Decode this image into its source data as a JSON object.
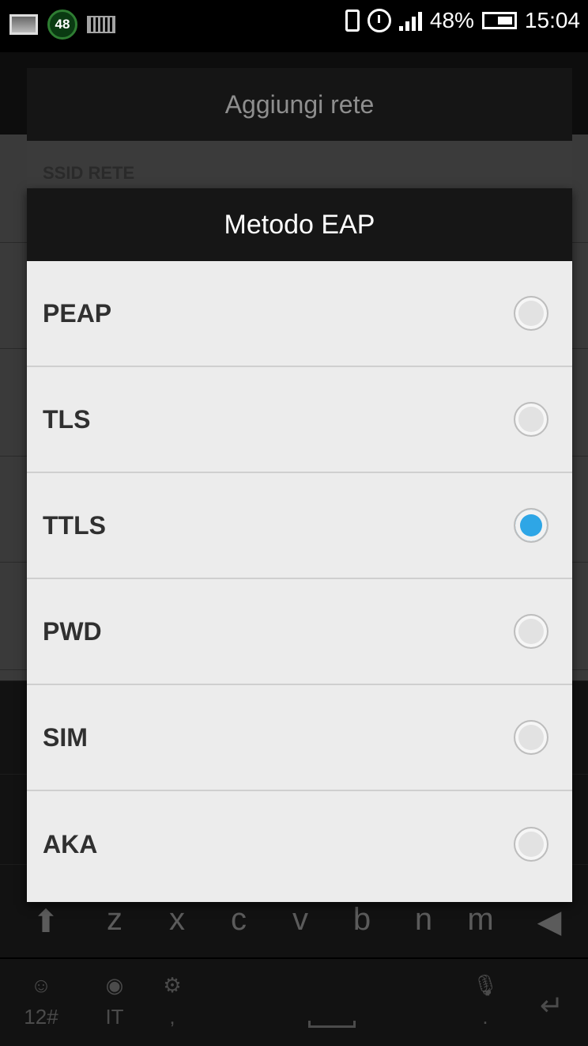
{
  "status_bar": {
    "badge_number": "48",
    "battery_percent": "48%",
    "time": "15:04"
  },
  "background_dialog": {
    "title": "Aggiungi rete",
    "ssid_label": "SSID RETE"
  },
  "eap_dialog": {
    "title": "Metodo EAP",
    "options": [
      {
        "label": "PEAP",
        "selected": false
      },
      {
        "label": "TLS",
        "selected": false
      },
      {
        "label": "TTLS",
        "selected": true
      },
      {
        "label": "PWD",
        "selected": false
      },
      {
        "label": "SIM",
        "selected": false
      },
      {
        "label": "AKA",
        "selected": false
      }
    ]
  },
  "keyboard": {
    "letters_row": [
      "z",
      "x",
      "c",
      "v",
      "b",
      "n",
      "m"
    ],
    "bottom_row": {
      "emoji_label": "12#",
      "language_label": "IT",
      "comma_label": ",",
      "period_label": "."
    }
  },
  "colors": {
    "accent": "#2ea6e6",
    "dialog_background": "#ececec",
    "title_bar": "#161616"
  }
}
